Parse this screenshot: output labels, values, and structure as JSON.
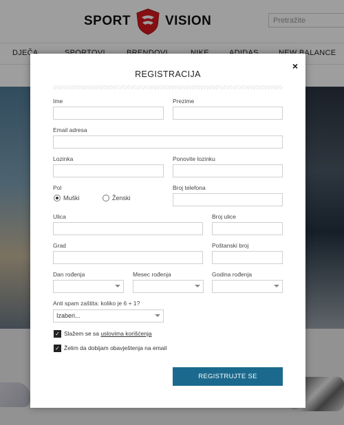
{
  "header": {
    "logo_left": "SPORT",
    "logo_right": "VISION",
    "search_placeholder": "Pretražite"
  },
  "nav": {
    "items": [
      "DJEČA",
      "SPORTOVI",
      "BRENDOVI",
      "NIKE",
      "ADIDAS",
      "NEW BALANCE"
    ]
  },
  "modal": {
    "title": "REGISTRACIJA",
    "close_glyph": "×",
    "labels": {
      "ime": "Ime",
      "prezime": "Prezime",
      "email": "Email adresa",
      "lozinka": "Lozinka",
      "ponovite": "Ponovite lozinku",
      "pol": "Pol",
      "telefon": "Broj telefona",
      "ulica": "Ulica",
      "broj_ulice": "Broj ulice",
      "grad": "Grad",
      "postanski": "Poštanski broj",
      "dan": "Dan rođenja",
      "mesec": "Mesec rođenja",
      "godina": "Godina rođenja",
      "antispam": "Anti spam zaštita: koliko je 6 + 1?"
    },
    "gender": {
      "male": "Muški",
      "female": "Ženski",
      "selected": "male"
    },
    "antispam_select": "Izaberi...",
    "terms_prefix": "Slažem se sa ",
    "terms_link": "uslovima korišćenja",
    "newsletter": "Želim da dobijam obavještenja na email",
    "submit": "REGISTRUJTE SE"
  },
  "colors": {
    "accent": "#1b6a8e",
    "overlay": "rgba(0,0,0,0.38)"
  }
}
